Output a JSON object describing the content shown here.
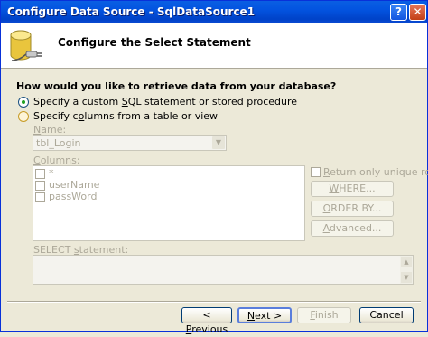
{
  "window": {
    "title": "Configure Data Source - SqlDataSource1",
    "help_glyph": "?",
    "close_glyph": "✕"
  },
  "header": {
    "title": "Configure the Select Statement",
    "icon": "database-icon"
  },
  "question": "How would you like to retrieve data from your database?",
  "options": [
    {
      "label_pre": "Specify a custom ",
      "label_accel": "S",
      "label_post": "QL statement or stored procedure",
      "selected": true
    },
    {
      "label_pre": "Specify c",
      "label_accel": "o",
      "label_post": "lumns from a table or view",
      "selected": false
    }
  ],
  "name_field": {
    "label_accel": "N",
    "label_post": "ame:",
    "value": "tbl_Login"
  },
  "columns": {
    "label_accel": "C",
    "label_post": "olumns:",
    "items": [
      {
        "label": "*"
      },
      {
        "label": "userName"
      },
      {
        "label": "passWord"
      }
    ]
  },
  "unique_rows": {
    "label_accel": "R",
    "label_post": "eturn only unique rows"
  },
  "side_buttons": [
    {
      "label_accel": "W",
      "label_post": "HERE..."
    },
    {
      "label_accel": "O",
      "label_post": "RDER BY..."
    },
    {
      "label_accel": "A",
      "label_post": "dvanced..."
    }
  ],
  "select_statement": {
    "label_pre": "SELECT ",
    "label_accel": "s",
    "label_post": "tatement:",
    "value": ""
  },
  "footer": {
    "previous": {
      "label_pre": "< ",
      "label_accel": "P",
      "label_post": "revious"
    },
    "next": {
      "label_accel": "N",
      "label_post": "ext >"
    },
    "finish": {
      "label_accel": "F",
      "label_post": "inish"
    },
    "cancel": {
      "label": "Cancel"
    }
  }
}
